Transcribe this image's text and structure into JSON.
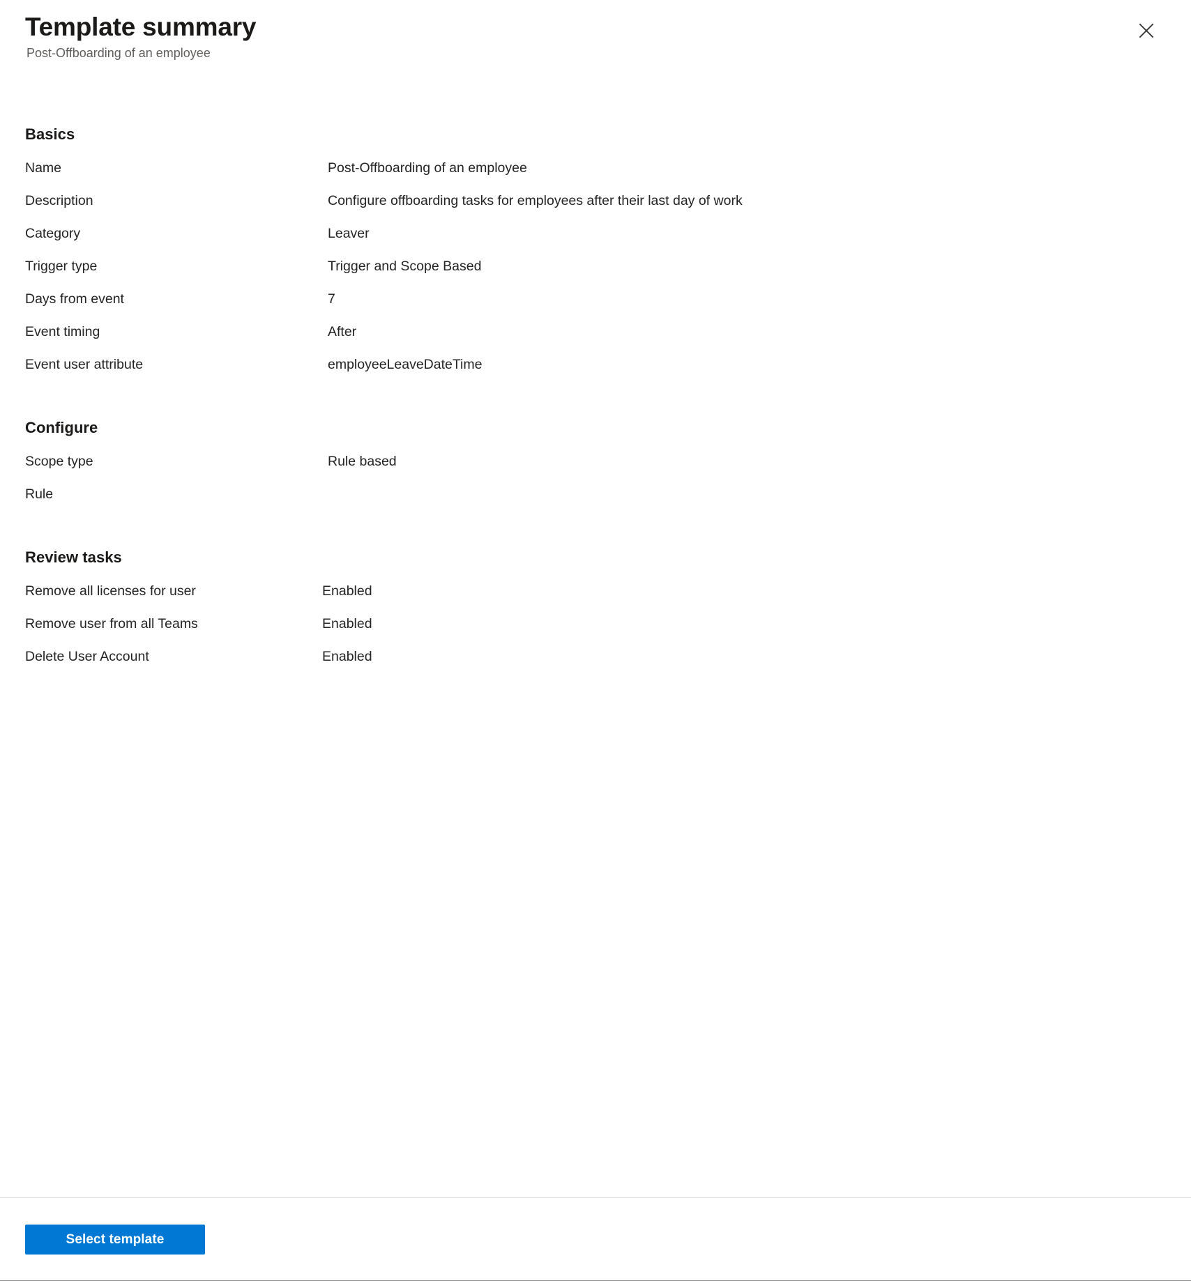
{
  "header": {
    "title": "Template summary",
    "subtitle": "Post-Offboarding of an employee",
    "close_icon": "close-icon"
  },
  "sections": [
    {
      "heading": "Basics",
      "rows": [
        {
          "label": "Name",
          "value": "Post-Offboarding of an employee"
        },
        {
          "label": "Description",
          "value": "Configure offboarding tasks for employees after their last day of work"
        },
        {
          "label": "Category",
          "value": "Leaver"
        },
        {
          "label": "Trigger type",
          "value": "Trigger and Scope Based"
        },
        {
          "label": "Days from event",
          "value": "7"
        },
        {
          "label": "Event timing",
          "value": "After"
        },
        {
          "label": "Event user attribute",
          "value": "employeeLeaveDateTime"
        }
      ]
    },
    {
      "heading": "Configure",
      "rows": [
        {
          "label": "Scope type",
          "value": "Rule based"
        },
        {
          "label": "Rule",
          "value": ""
        }
      ]
    },
    {
      "heading": "Review tasks",
      "rows": [
        {
          "label": "Remove all licenses for user",
          "value": "Enabled"
        },
        {
          "label": "Remove user from all Teams",
          "value": "Enabled"
        },
        {
          "label": "Delete User Account",
          "value": "Enabled"
        }
      ]
    }
  ],
  "footer": {
    "select_template_label": "Select template"
  },
  "colors": {
    "accent": "#0078d4",
    "text_primary": "#242424",
    "text_secondary": "#605e5c",
    "divider": "#e1dfdd",
    "footer_border": "#8a8886",
    "background": "#ffffff"
  }
}
